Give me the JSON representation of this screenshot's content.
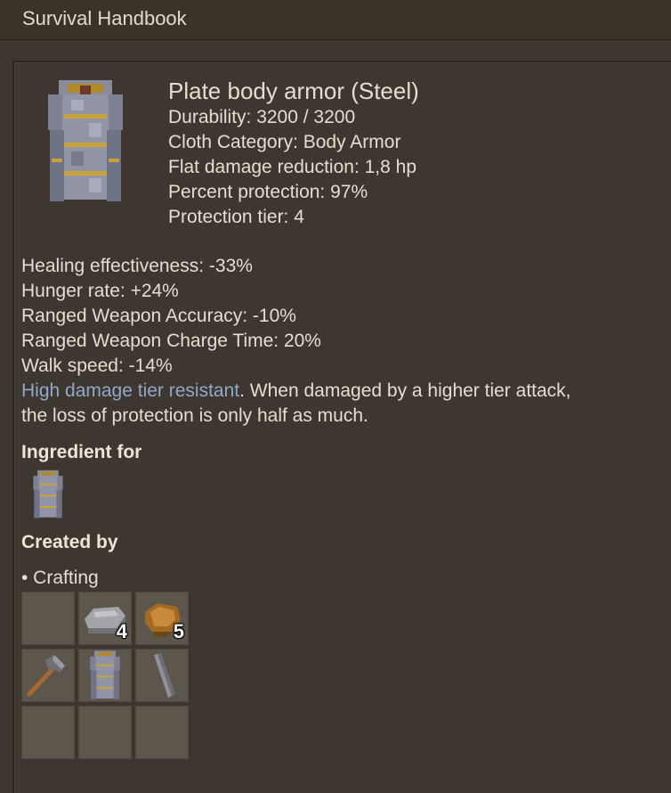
{
  "window": {
    "title": "Survival Handbook"
  },
  "item": {
    "name": "Plate body armor (Steel)",
    "icon": "plate-armor-icon",
    "stats": [
      "Durability: 3200 / 3200",
      "Cloth Category: Body Armor",
      "Flat damage reduction: 1,8 hp",
      "Percent protection: 97%",
      "Protection tier: 4"
    ],
    "modifiers": [
      "Healing effectiveness: -33%",
      "Hunger rate: +24%",
      "Ranged Weapon Accuracy: -10%",
      "Ranged Weapon Charge Time: 20%",
      "Walk speed: -14%"
    ],
    "resist": {
      "link": "High damage tier resistant",
      "text1": ". When damaged by a higher tier attack,",
      "text2": "the loss of protection is only half as much."
    }
  },
  "ingredient_for": {
    "heading": "Ingredient for",
    "items": [
      "plate-armor-icon"
    ]
  },
  "created_by": {
    "heading": "Created by",
    "method": "• Crafting",
    "grid": [
      {
        "icon": "",
        "count": ""
      },
      {
        "icon": "iron-plate-icon",
        "count": "4"
      },
      {
        "icon": "leather-icon",
        "count": "5"
      },
      {
        "icon": "hammer-icon",
        "count": ""
      },
      {
        "icon": "plate-armor-icon",
        "count": ""
      },
      {
        "icon": "metal-bar-icon",
        "count": ""
      },
      {
        "icon": "",
        "count": ""
      },
      {
        "icon": "",
        "count": ""
      },
      {
        "icon": "",
        "count": ""
      }
    ]
  },
  "colors": {
    "link": "#8fa8cc",
    "background": "#3e372f",
    "slot": "#5c564d"
  }
}
